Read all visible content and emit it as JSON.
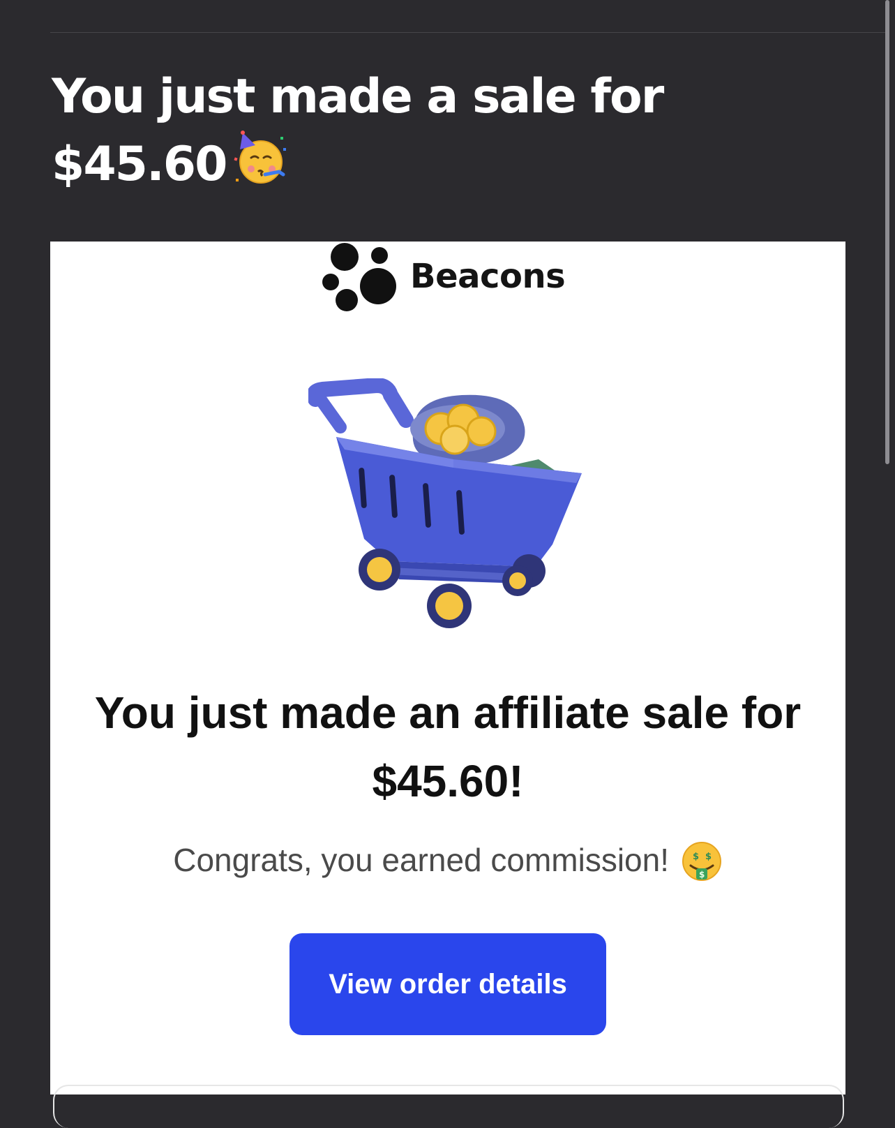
{
  "email": {
    "subject_text": "You just made a sale for $45.60",
    "subject_emoji": "partying-face-icon"
  },
  "card": {
    "brand_name": "Beacons",
    "brand_logo_icon": "beacons-dots-logo",
    "illustration_icon": "shopping-cart-with-money-icon",
    "headline": "You just made an affiliate sale for $45.60!",
    "subline": "Congrats, you earned commission!",
    "subline_emoji": "money-mouth-face-icon",
    "cta_label": "View order details"
  },
  "colors": {
    "background": "#2b2a2e",
    "card_background": "#ffffff",
    "cta_background": "#2a46ec",
    "cta_text": "#ffffff"
  }
}
